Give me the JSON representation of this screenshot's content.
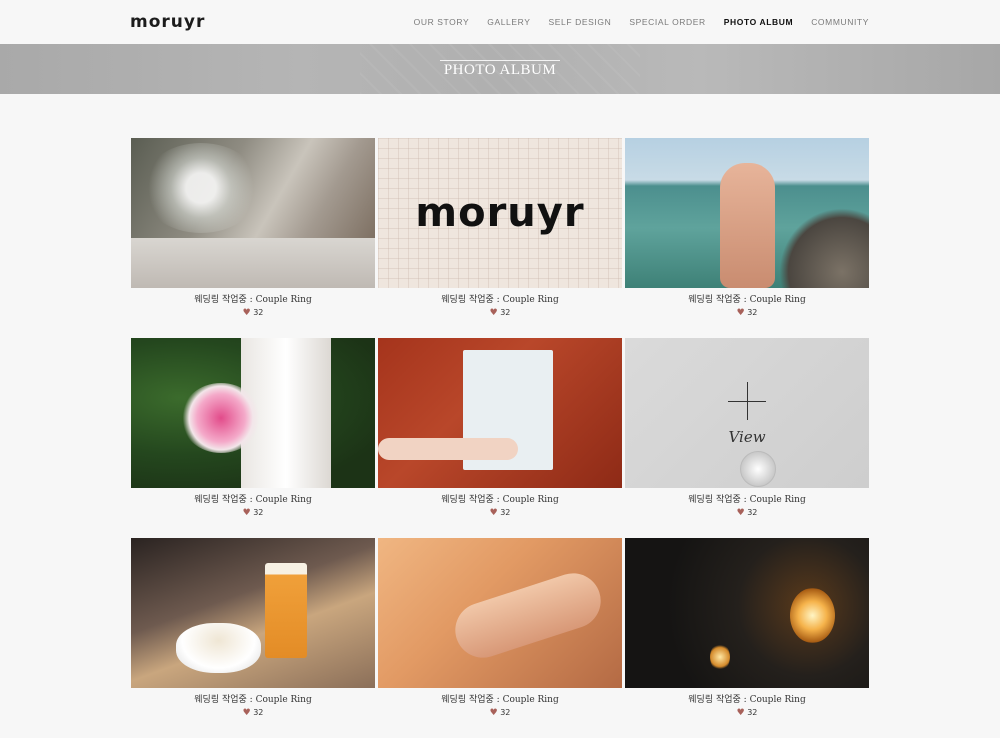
{
  "header": {
    "logo": "moruyr",
    "nav": [
      "OUR STORY",
      "GALLERY",
      "SELF DESIGN",
      "SPECIAL ORDER",
      "PHOTO ALBUM",
      "COMMUNITY"
    ],
    "active_nav": "PHOTO ALBUM"
  },
  "banner": {
    "title": "PHOTO ALBUM"
  },
  "album": {
    "items": [
      {
        "title": "웨딩링 작업중 : Couple Ring",
        "likes": "32",
        "photo": "wedding-table-flowers"
      },
      {
        "title": "웨딩링 작업중 : Couple Ring",
        "likes": "32",
        "photo": "moruyr-logo-sketch",
        "logo_text": "moruyr"
      },
      {
        "title": "웨딩링 작업중 : Couple Ring",
        "likes": "32",
        "photo": "peace-sign-sea"
      },
      {
        "title": "웨딩링 작업중 : Couple Ring",
        "likes": "32",
        "photo": "bride-bouquet"
      },
      {
        "title": "웨딩링 작업중 : Couple Ring",
        "likes": "32",
        "photo": "drawing-on-desk"
      },
      {
        "title": "웨딩링 작업중 : Couple Ring",
        "likes": "32",
        "photo": "necklace-pendant",
        "hover_label": "View"
      },
      {
        "title": "웨딩링 작업중 : Couple Ring",
        "likes": "32",
        "photo": "coffee-and-beer"
      },
      {
        "title": "웨딩링 작업중 : Couple Ring",
        "likes": "32",
        "photo": "bracelet-wrist"
      },
      {
        "title": "웨딩링 작업중 : Couple Ring",
        "likes": "32",
        "photo": "edison-bulbs"
      }
    ]
  },
  "icons": {
    "like": "heart-icon",
    "hover": "plus-icon"
  },
  "colors": {
    "heart": "#a8615a",
    "banner": "#b0b0b0",
    "background": "#f7f7f7"
  }
}
